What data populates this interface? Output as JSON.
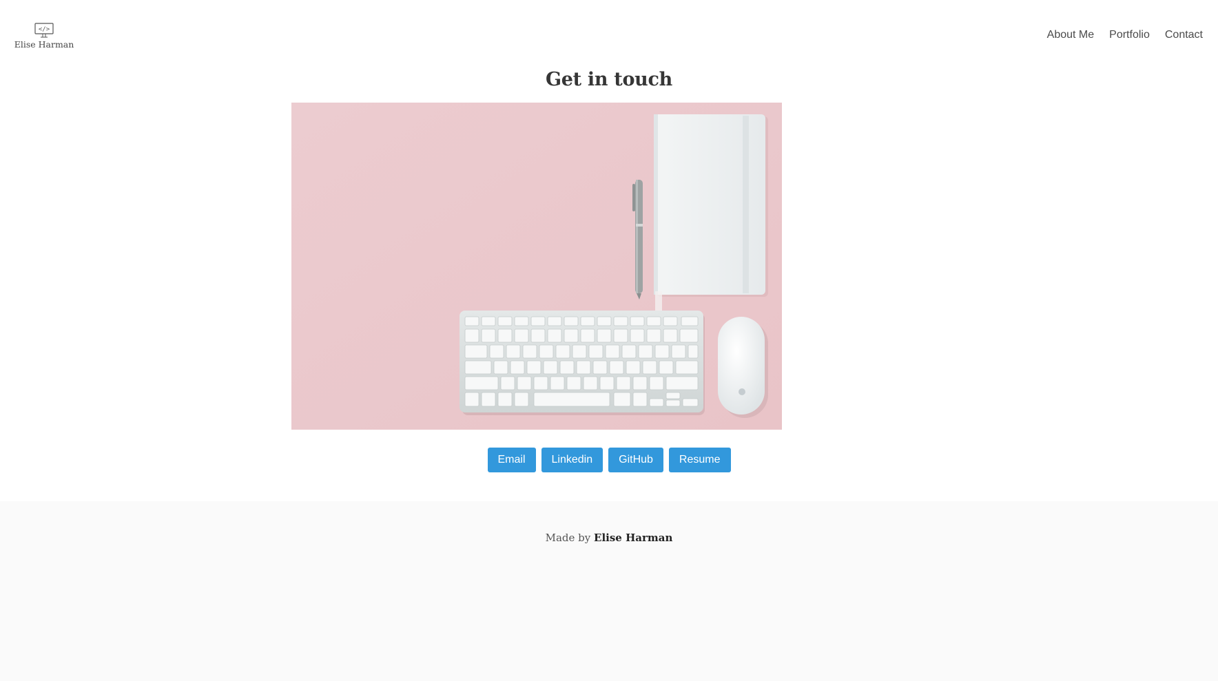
{
  "header": {
    "logo_text": "Elise Harman",
    "logo_icon": "code-monitor-icon",
    "nav": [
      {
        "label": "About Me"
      },
      {
        "label": "Portfolio"
      },
      {
        "label": "Contact"
      }
    ]
  },
  "main": {
    "title": "Get in touch",
    "hero_image": "desk-with-keyboard-mouse-notebook-pen",
    "buttons": [
      {
        "label": "Email"
      },
      {
        "label": "Linkedin"
      },
      {
        "label": "GitHub"
      },
      {
        "label": "Resume"
      }
    ]
  },
  "footer": {
    "prefix": "Made by",
    "author": "Elise Harman"
  },
  "colors": {
    "button": "#3298dc",
    "hero_background": "#ecc8cb",
    "footer_background": "#fafafa"
  }
}
